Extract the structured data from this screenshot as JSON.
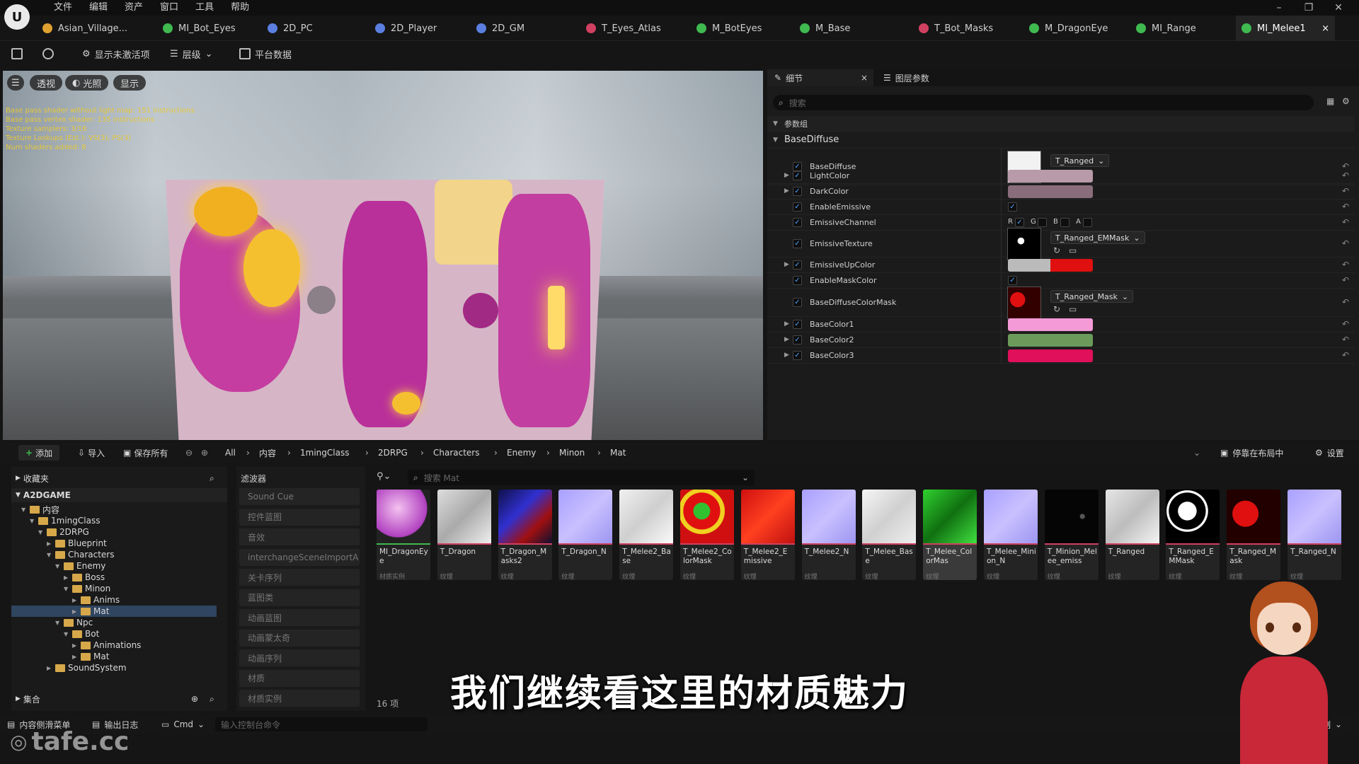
{
  "app": {
    "logo_text": "U"
  },
  "menu": [
    "文件",
    "编辑",
    "资产",
    "窗口",
    "工具",
    "帮助"
  ],
  "window_controls": [
    "–",
    "❐",
    "✕"
  ],
  "doc_tabs": [
    {
      "label": "Asian_Village...",
      "color": "#e0a030"
    },
    {
      "label": "MI_Bot_Eyes",
      "color": "#3fb950"
    },
    {
      "label": "2D_PC",
      "color": "#5a7fe0"
    },
    {
      "label": "2D_Player",
      "color": "#5a7fe0"
    },
    {
      "label": "2D_GM",
      "color": "#5a7fe0"
    },
    {
      "label": "T_Eyes_Atlas",
      "color": "#d04060"
    },
    {
      "label": "M_BotEyes",
      "color": "#3fb950"
    },
    {
      "label": "M_Base",
      "color": "#3fb950"
    },
    {
      "label": "T_Bot_Masks",
      "color": "#d04060"
    },
    {
      "label": "M_DragonEye",
      "color": "#3fb950"
    },
    {
      "label": "MI_Range",
      "color": "#3fb950"
    },
    {
      "label": "MI_Melee1",
      "color": "#3fb950"
    }
  ],
  "doc_tab_close": "×",
  "toolbar": {
    "show_inactive": "显示未激活项",
    "hierarchy": "层级",
    "platform_stats": "平台数据"
  },
  "viewport": {
    "perspective": "透视",
    "lit": "光照",
    "show": "显示",
    "stats": "Base pass shader without light map: 151 instructions\nBase pass vertex shader: 135 instructions\nTexture samplers: 3/16\nTexture Lookups (Est.): VS(3), PS(3)\nNum shaders added: 8"
  },
  "details": {
    "tab_details": "细节",
    "tab_layer_params": "图层参数",
    "search_placeholder": "搜索",
    "group_header": "参数组",
    "section": "BaseDiffuse",
    "params": [
      {
        "label": "BaseDiffuse",
        "kind": "texture",
        "asset": "T_Ranged"
      },
      {
        "label": "LightColor",
        "kind": "color",
        "color": "#b89aa8"
      },
      {
        "label": "DarkColor",
        "kind": "color",
        "color": "#8a6d7a"
      },
      {
        "label": "EnableEmissive",
        "kind": "bool"
      },
      {
        "label": "EmissiveChannel",
        "kind": "channels",
        "channels": [
          "R",
          "G",
          "B",
          "A"
        ]
      },
      {
        "label": "EmissiveTexture",
        "kind": "texture",
        "asset": "T_Ranged_EMMask"
      },
      {
        "label": "EmissiveUpColor",
        "kind": "color",
        "color": "#e01010"
      },
      {
        "label": "EnableMaskColor",
        "kind": "bool"
      },
      {
        "label": "BaseDiffuseColorMask",
        "kind": "texture",
        "asset": "T_Ranged_Mask"
      },
      {
        "label": "BaseColor1",
        "kind": "color",
        "color": "#f49ad6"
      },
      {
        "label": "BaseColor2",
        "kind": "color",
        "color": "#6b9a5a"
      },
      {
        "label": "BaseColor3",
        "kind": "color",
        "color": "#e0105a"
      }
    ]
  },
  "content_bar": {
    "add": "添加",
    "import": "导入",
    "save_all": "保存所有",
    "breadcrumbs": [
      "All",
      "内容",
      "1mingClass",
      "2DRPG",
      "Characters",
      "Enemy",
      "Minon",
      "Mat"
    ],
    "dock_label": "停靠在布局中",
    "settings": "设置"
  },
  "left_panel": {
    "favorites": "收藏夹",
    "project": "A2DGAME",
    "tree": [
      {
        "label": "内容",
        "depth": 0
      },
      {
        "label": "1mingClass",
        "depth": 1
      },
      {
        "label": "2DRPG",
        "depth": 2
      },
      {
        "label": "Blueprint",
        "depth": 3
      },
      {
        "label": "Characters",
        "depth": 3
      },
      {
        "label": "Enemy",
        "depth": 4
      },
      {
        "label": "Boss",
        "depth": 5
      },
      {
        "label": "Minon",
        "depth": 5
      },
      {
        "label": "Anims",
        "depth": 6
      },
      {
        "label": "Mat",
        "depth": 6
      },
      {
        "label": "Npc",
        "depth": 4
      },
      {
        "label": "Bot",
        "depth": 5
      },
      {
        "label": "Animations",
        "depth": 6
      },
      {
        "label": "Mat",
        "depth": 6
      },
      {
        "label": "SoundSystem",
        "depth": 3
      }
    ],
    "collections": "集合"
  },
  "filters": {
    "title": "滤波器",
    "items": [
      "Sound Cue",
      "控件蓝图",
      "音效",
      "interchangeSceneImportA",
      "关卡序列",
      "蓝图类",
      "动画蓝图",
      "动画蒙太奇",
      "动画序列",
      "材质",
      "材质实例"
    ]
  },
  "assets": {
    "search_placeholder": "搜索 Mat",
    "count": "16 项",
    "items": [
      {
        "name": "MI_DragonEye",
        "type": "材质实例",
        "bar": "#3fb950"
      },
      {
        "name": "T_Dragon",
        "type": "纹理",
        "bar": "#d04060"
      },
      {
        "name": "T_Dragon_Masks2",
        "type": "纹理",
        "bar": "#d04060"
      },
      {
        "name": "T_Dragon_N",
        "type": "纹理",
        "bar": "#d04060"
      },
      {
        "name": "T_Melee2_Base",
        "type": "纹理",
        "bar": "#d04060"
      },
      {
        "name": "T_Melee2_ColorMask",
        "type": "纹理",
        "bar": "#d04060"
      },
      {
        "name": "T_Melee2_Emissive",
        "type": "纹理",
        "bar": "#d04060"
      },
      {
        "name": "T_Melee2_N",
        "type": "纹理",
        "bar": "#d04060"
      },
      {
        "name": "T_Melee_Base",
        "type": "纹理",
        "bar": "#d04060"
      },
      {
        "name": "T_Melee_ColorMas",
        "type": "纹理",
        "bar": "#d04060"
      },
      {
        "name": "T_Melee_Minion_N",
        "type": "纹理",
        "bar": "#d04060"
      },
      {
        "name": "T_Minion_Melee_emiss",
        "type": "纹理",
        "bar": "#d04060"
      },
      {
        "name": "T_Ranged",
        "type": "纹理",
        "bar": "#d04060"
      },
      {
        "name": "T_Ranged_EMMask",
        "type": "纹理",
        "bar": "#d04060"
      },
      {
        "name": "T_Ranged_Mask",
        "type": "纹理",
        "bar": "#d04060"
      },
      {
        "name": "T_Ranged_N",
        "type": "纹理",
        "bar": "#d04060"
      }
    ]
  },
  "statusbar": {
    "content_drawer": "内容侧滑菜单",
    "output_log": "输出日志",
    "cmd": "Cmd",
    "console_placeholder": "输入控制台命令",
    "right_label": "制"
  },
  "subtitle": "我们继续看这里的材质魅力",
  "watermark": "tafe.cc"
}
